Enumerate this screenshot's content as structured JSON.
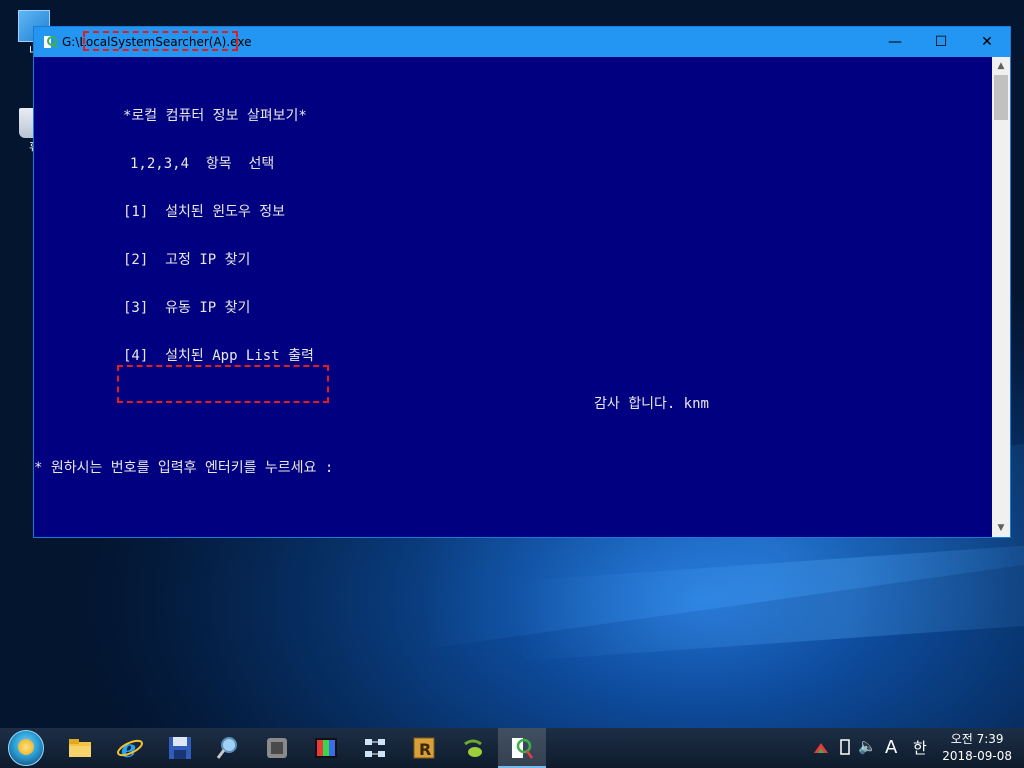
{
  "window": {
    "title": "G:\\LocalSystemSearcher(A).exe",
    "controls": {
      "minimize": "—",
      "maximize": "☐",
      "close": "✕"
    }
  },
  "console": {
    "heading": "*로컬 컴퓨터 정보 살펴보기*",
    "choose": "1,2,3,4  항목  선택",
    "options": [
      "[1]  설치된 윈도우 정보",
      "[2]  고정 IP 찾기",
      "[3]  유동 IP 찾기",
      "[4]  설치된 App List 출력"
    ],
    "thanks": "감사 합니다. knm",
    "prompt": "* 원하시는 번호를 입력후 엔터키를 누르세요 :"
  },
  "desktop": {
    "icon_pc_label": "내",
    "icon_bin_label": "휴"
  },
  "taskbar": {
    "apps": [
      "start-orb",
      "file-explorer-icon",
      "internet-explorer-icon",
      "floppy-save-icon",
      "magnifier-search-icon",
      "transformer-app-icon",
      "color-picker-app-icon",
      "network-app-icon",
      "r-app-icon",
      "green-leaf-app-icon",
      "local-system-searcher-icon"
    ]
  },
  "tray": {
    "lang_indicator": "A",
    "ime_mode": "한",
    "clock_time": "오전 7:39",
    "clock_date": "2018-09-08"
  },
  "colors": {
    "console_bg": "#000080",
    "console_text": "#e8e8e8",
    "titlebar": "#2396f3",
    "highlight": "#e81b1b"
  }
}
